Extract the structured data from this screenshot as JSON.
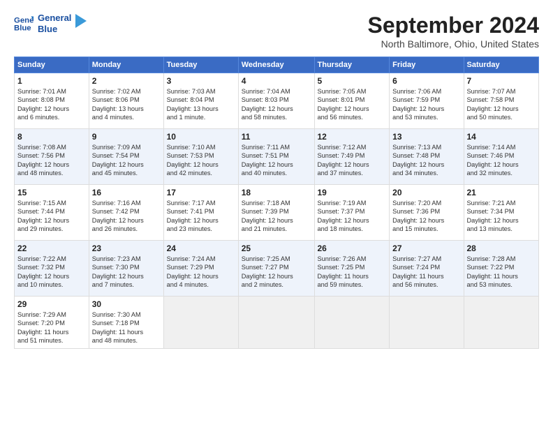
{
  "logo": {
    "line1": "General",
    "line2": "Blue"
  },
  "title": "September 2024",
  "location": "North Baltimore, Ohio, United States",
  "headers": [
    "Sunday",
    "Monday",
    "Tuesday",
    "Wednesday",
    "Thursday",
    "Friday",
    "Saturday"
  ],
  "weeks": [
    [
      {
        "day": "1",
        "info": "Sunrise: 7:01 AM\nSunset: 8:08 PM\nDaylight: 12 hours\nand 6 minutes."
      },
      {
        "day": "2",
        "info": "Sunrise: 7:02 AM\nSunset: 8:06 PM\nDaylight: 13 hours\nand 4 minutes."
      },
      {
        "day": "3",
        "info": "Sunrise: 7:03 AM\nSunset: 8:04 PM\nDaylight: 13 hours\nand 1 minute."
      },
      {
        "day": "4",
        "info": "Sunrise: 7:04 AM\nSunset: 8:03 PM\nDaylight: 12 hours\nand 58 minutes."
      },
      {
        "day": "5",
        "info": "Sunrise: 7:05 AM\nSunset: 8:01 PM\nDaylight: 12 hours\nand 56 minutes."
      },
      {
        "day": "6",
        "info": "Sunrise: 7:06 AM\nSunset: 7:59 PM\nDaylight: 12 hours\nand 53 minutes."
      },
      {
        "day": "7",
        "info": "Sunrise: 7:07 AM\nSunset: 7:58 PM\nDaylight: 12 hours\nand 50 minutes."
      }
    ],
    [
      {
        "day": "8",
        "info": "Sunrise: 7:08 AM\nSunset: 7:56 PM\nDaylight: 12 hours\nand 48 minutes."
      },
      {
        "day": "9",
        "info": "Sunrise: 7:09 AM\nSunset: 7:54 PM\nDaylight: 12 hours\nand 45 minutes."
      },
      {
        "day": "10",
        "info": "Sunrise: 7:10 AM\nSunset: 7:53 PM\nDaylight: 12 hours\nand 42 minutes."
      },
      {
        "day": "11",
        "info": "Sunrise: 7:11 AM\nSunset: 7:51 PM\nDaylight: 12 hours\nand 40 minutes."
      },
      {
        "day": "12",
        "info": "Sunrise: 7:12 AM\nSunset: 7:49 PM\nDaylight: 12 hours\nand 37 minutes."
      },
      {
        "day": "13",
        "info": "Sunrise: 7:13 AM\nSunset: 7:48 PM\nDaylight: 12 hours\nand 34 minutes."
      },
      {
        "day": "14",
        "info": "Sunrise: 7:14 AM\nSunset: 7:46 PM\nDaylight: 12 hours\nand 32 minutes."
      }
    ],
    [
      {
        "day": "15",
        "info": "Sunrise: 7:15 AM\nSunset: 7:44 PM\nDaylight: 12 hours\nand 29 minutes."
      },
      {
        "day": "16",
        "info": "Sunrise: 7:16 AM\nSunset: 7:42 PM\nDaylight: 12 hours\nand 26 minutes."
      },
      {
        "day": "17",
        "info": "Sunrise: 7:17 AM\nSunset: 7:41 PM\nDaylight: 12 hours\nand 23 minutes."
      },
      {
        "day": "18",
        "info": "Sunrise: 7:18 AM\nSunset: 7:39 PM\nDaylight: 12 hours\nand 21 minutes."
      },
      {
        "day": "19",
        "info": "Sunrise: 7:19 AM\nSunset: 7:37 PM\nDaylight: 12 hours\nand 18 minutes."
      },
      {
        "day": "20",
        "info": "Sunrise: 7:20 AM\nSunset: 7:36 PM\nDaylight: 12 hours\nand 15 minutes."
      },
      {
        "day": "21",
        "info": "Sunrise: 7:21 AM\nSunset: 7:34 PM\nDaylight: 12 hours\nand 13 minutes."
      }
    ],
    [
      {
        "day": "22",
        "info": "Sunrise: 7:22 AM\nSunset: 7:32 PM\nDaylight: 12 hours\nand 10 minutes."
      },
      {
        "day": "23",
        "info": "Sunrise: 7:23 AM\nSunset: 7:30 PM\nDaylight: 12 hours\nand 7 minutes."
      },
      {
        "day": "24",
        "info": "Sunrise: 7:24 AM\nSunset: 7:29 PM\nDaylight: 12 hours\nand 4 minutes."
      },
      {
        "day": "25",
        "info": "Sunrise: 7:25 AM\nSunset: 7:27 PM\nDaylight: 12 hours\nand 2 minutes."
      },
      {
        "day": "26",
        "info": "Sunrise: 7:26 AM\nSunset: 7:25 PM\nDaylight: 11 hours\nand 59 minutes."
      },
      {
        "day": "27",
        "info": "Sunrise: 7:27 AM\nSunset: 7:24 PM\nDaylight: 11 hours\nand 56 minutes."
      },
      {
        "day": "28",
        "info": "Sunrise: 7:28 AM\nSunset: 7:22 PM\nDaylight: 11 hours\nand 53 minutes."
      }
    ],
    [
      {
        "day": "29",
        "info": "Sunrise: 7:29 AM\nSunset: 7:20 PM\nDaylight: 11 hours\nand 51 minutes."
      },
      {
        "day": "30",
        "info": "Sunrise: 7:30 AM\nSunset: 7:18 PM\nDaylight: 11 hours\nand 48 minutes."
      },
      {
        "day": "",
        "info": ""
      },
      {
        "day": "",
        "info": ""
      },
      {
        "day": "",
        "info": ""
      },
      {
        "day": "",
        "info": ""
      },
      {
        "day": "",
        "info": ""
      }
    ]
  ]
}
